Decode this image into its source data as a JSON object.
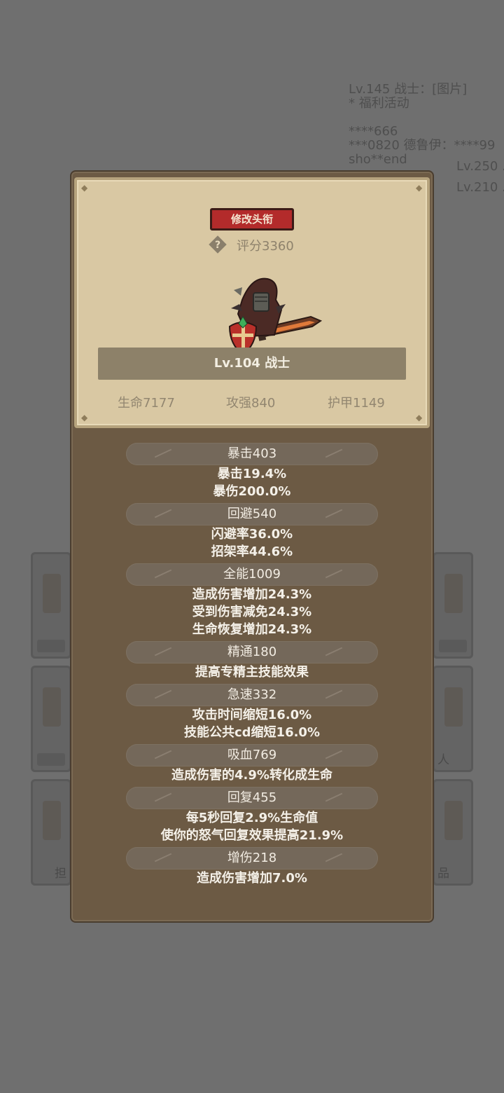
{
  "background": {
    "chat_lines": [
      "Lv.145 战士：[图片]",
      "* 福利活动",
      "****666",
      "***0820 德鲁伊：****99",
      "sho**end",
      "Lv.250 ...",
      "Lv.210 ..."
    ],
    "tile_labels": [
      "人",
      "品",
      "担"
    ]
  },
  "header": {
    "title_button": "修改头衔",
    "help_icon": "question-icon",
    "score": "评分3360",
    "hero_name": "Lv.104 战士",
    "basic_stats": [
      {
        "label": "生命7177"
      },
      {
        "label": "攻强840"
      },
      {
        "label": "护甲1149"
      }
    ]
  },
  "stats": [
    {
      "title": "暴击403",
      "lines": [
        "暴击19.4%",
        "暴伤200.0%"
      ]
    },
    {
      "title": "回避540",
      "lines": [
        "闪避率36.0%",
        "招架率44.6%"
      ]
    },
    {
      "title": "全能1009",
      "lines": [
        "造成伤害增加24.3%",
        "受到伤害减免24.3%",
        "生命恢复增加24.3%"
      ]
    },
    {
      "title": "精通180",
      "lines": [
        "提高专精主技能效果"
      ]
    },
    {
      "title": "急速332",
      "lines": [
        "攻击时间缩短16.0%",
        "技能公共cd缩短16.0%"
      ]
    },
    {
      "title": "吸血769",
      "lines": [
        "造成伤害的4.9%转化成生命"
      ]
    },
    {
      "title": "回复455",
      "lines": [
        "每5秒回复2.9%生命值",
        "使你的怒气回复效果提高21.9%"
      ]
    },
    {
      "title": "增伤218",
      "lines": [
        "造成伤害增加7.0%"
      ]
    }
  ]
}
